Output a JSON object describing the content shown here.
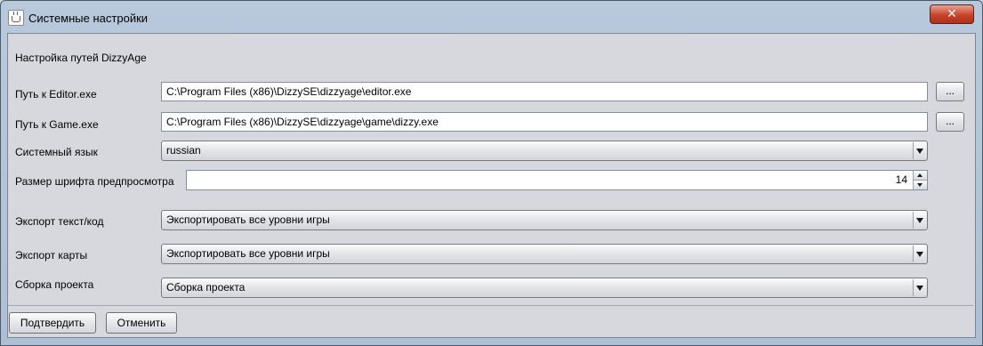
{
  "window": {
    "title": "Системные настройки",
    "close_label": "✕"
  },
  "form": {
    "section_title": "Настройка путей DizzyAge",
    "editor_path": {
      "label": "Путь к Editor.exe",
      "value": "C:\\Program Files (x86)\\DizzySE\\dizzyage\\editor.exe",
      "browse_label": "..."
    },
    "game_path": {
      "label": "Путь к Game.exe",
      "value": "C:\\Program Files (x86)\\DizzySE\\dizzyage\\game\\dizzy.exe",
      "browse_label": "..."
    },
    "system_language": {
      "label": "Системный язык",
      "value": "russian"
    },
    "preview_font_size": {
      "label": "Размер шрифта предпросмотра",
      "value": "14"
    },
    "export_text": {
      "label": "Экспорт текст/код",
      "value": "Экспортировать все уровни игры"
    },
    "export_map": {
      "label": "Экспорт карты",
      "value": "Экспортировать все уровни игры"
    },
    "project_build": {
      "label": "Сборка проекта",
      "value": "Сборка проекта"
    }
  },
  "buttons": {
    "confirm": "Подтвердить",
    "cancel": "Отменить"
  },
  "icons": {
    "app": "java-cup-icon",
    "close": "close-icon",
    "dropdown": "chevron-down-icon"
  }
}
